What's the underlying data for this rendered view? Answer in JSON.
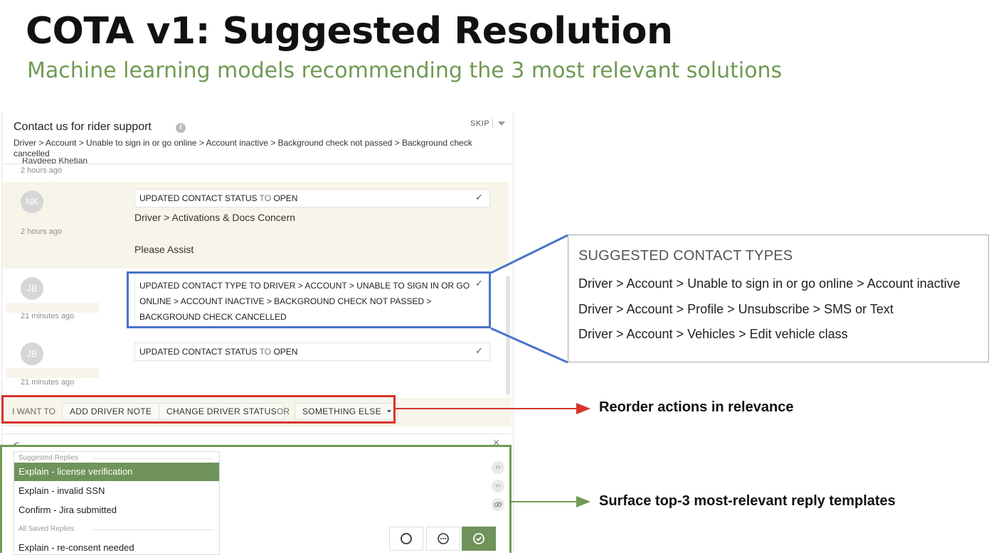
{
  "slide": {
    "title": "COTA v1: Suggested Resolution",
    "subtitle": "Machine learning models recommending the 3 most relevant solutions"
  },
  "panel": {
    "header_title": "Contact us for rider support",
    "info_icon": "info-icon",
    "skip_label": "SKIP",
    "breadcrumb": "Driver > Account > Unable to sign in or go online > Account inactive > Background check not passed > Background check cancelled",
    "cut_name": "Ravdeep Khetian",
    "cut_time": "2 hours ago"
  },
  "messages": [
    {
      "initials": "NK",
      "time": "2 hours ago",
      "status_parts": [
        "UPDATED CONTACT STATUS",
        " TO ",
        "OPEN"
      ],
      "body_line_1": "Driver > Activations & Docs Concern",
      "body_line_2": "Please Assist"
    },
    {
      "initials": "JB",
      "time": "21 minutes ago",
      "type_line_1": "UPDATED CONTACT TYPE TO DRIVER > ACCOUNT > UNABLE TO SIGN IN OR GO",
      "type_line_2": "ONLINE > ACCOUNT INACTIVE > BACKGROUND CHECK NOT PASSED >",
      "type_line_3": "BACKGROUND CHECK CANCELLED"
    },
    {
      "initials": "JB",
      "time": "21 minutes ago",
      "status_parts": [
        "UPDATED CONTACT STATUS",
        " TO ",
        "OPEN"
      ]
    }
  ],
  "actions": {
    "prefix": "I WANT TO",
    "add_note": "ADD DRIVER NOTE",
    "change_status": "CHANGE DRIVER STATUS",
    "or": "OR",
    "something_else": "SOMETHING ELSE"
  },
  "composer": {
    "back": "<",
    "close": "×",
    "suggested_label": "Suggested Replies",
    "suggested": [
      "Explain - license verification",
      "Explain - invalid SSN",
      "Confirm - Jira submitted"
    ],
    "saved_label": "All Saved Replies",
    "saved_first": "Explain - re-consent needed",
    "tools": [
      "code-icon",
      "code-icon",
      "link-icon"
    ],
    "send_buttons": [
      "circle-icon",
      "ellipsis-icon",
      "check-circle-icon"
    ]
  },
  "callout": {
    "title": "SUGGESTED CONTACT TYPES",
    "items": [
      "Driver > Account > Unable to sign in or go online > Account inactive",
      "Driver > Account > Profile > Unsubscribe > SMS or Text",
      "Driver > Account > Vehicles > Edit vehicle class"
    ]
  },
  "annotations": {
    "reorder": "Reorder actions in relevance",
    "surface": "Surface top-3 most-relevant reply templates"
  },
  "colors": {
    "blue": "#4a74c9",
    "red": "#d6342b",
    "green": "#6f9a52",
    "selected_reply": "#6f935a"
  }
}
